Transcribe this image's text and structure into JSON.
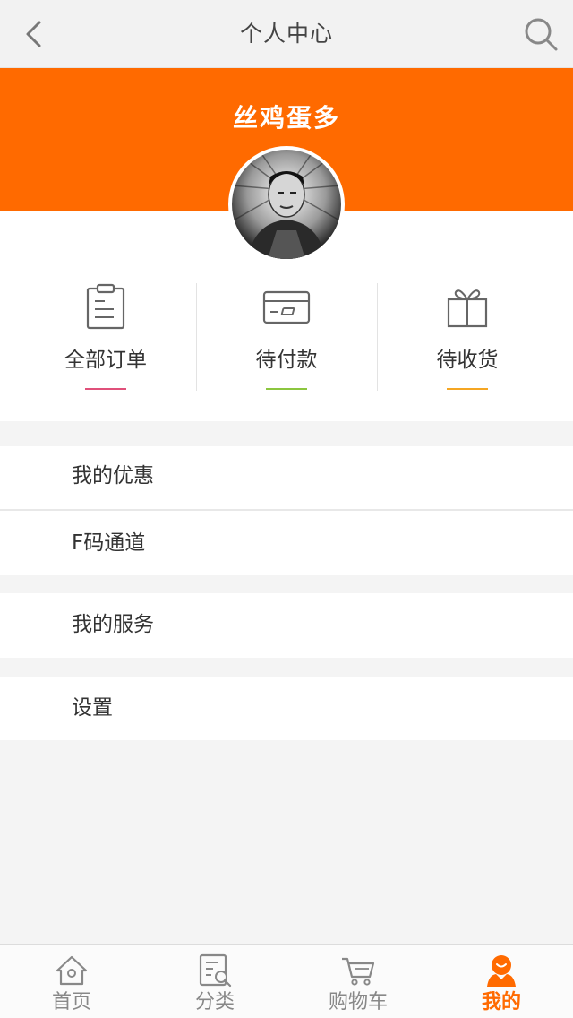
{
  "header": {
    "title": "个人中心"
  },
  "profile": {
    "username": "丝鸡蛋多"
  },
  "orders": [
    {
      "label": "全部订单",
      "accent": "#e0507a"
    },
    {
      "label": "待付款",
      "accent": "#8cc63f"
    },
    {
      "label": "待收货",
      "accent": "#f5a623"
    }
  ],
  "menu": {
    "coupons": "我的优惠",
    "fcode": "F码通道",
    "services": "我的服务",
    "settings": "设置"
  },
  "tabbar": {
    "home": "首页",
    "category": "分类",
    "cart": "购物车",
    "mine": "我的"
  },
  "colors": {
    "brand": "#ff6a00",
    "background": "#f4f4f4"
  }
}
